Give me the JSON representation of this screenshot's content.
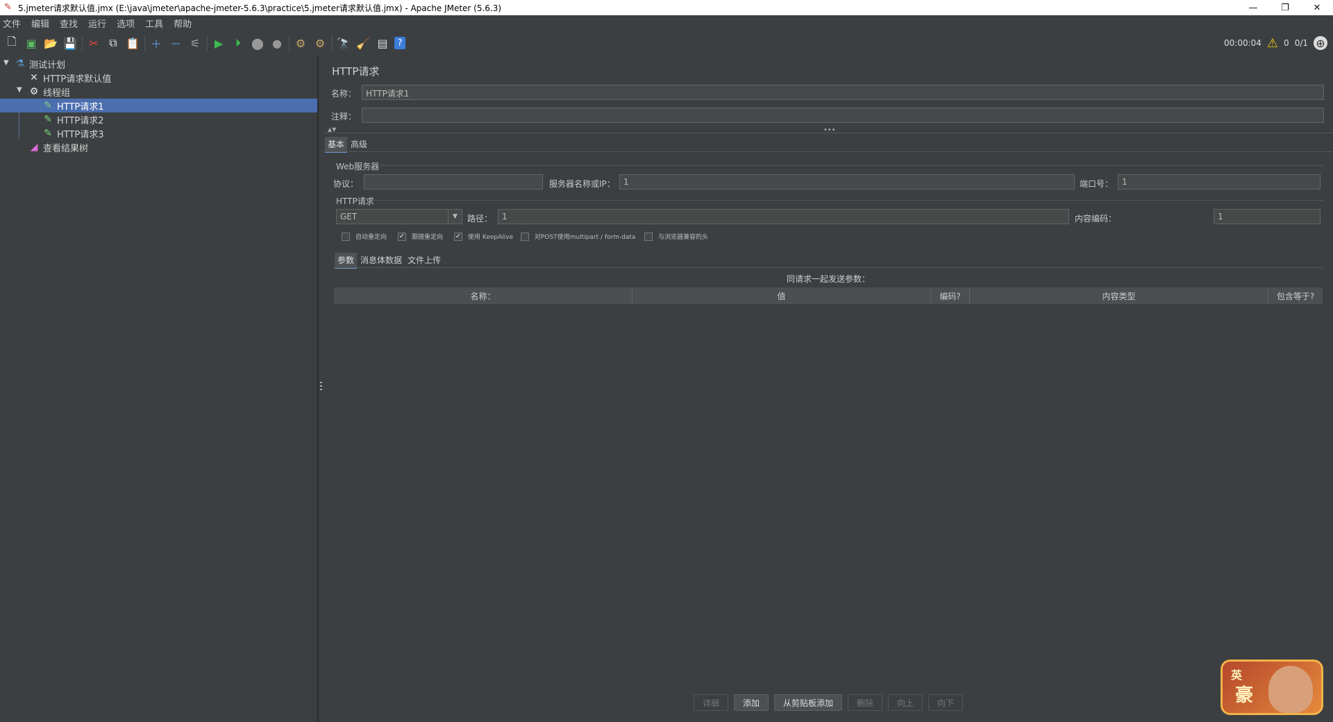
{
  "window": {
    "title": "5.jmeter请求默认值.jmx (E:\\java\\jmeter\\apache-jmeter-5.6.3\\practice\\5.jmeter请求默认值.jmx) - Apache JMeter (5.6.3)",
    "minimize": "—",
    "maximize": "❐",
    "close": "✕"
  },
  "menu": [
    "文件",
    "编辑",
    "查找",
    "运行",
    "选项",
    "工具",
    "帮助"
  ],
  "status": {
    "elapsed": "00:00:04",
    "warnings": "0",
    "threads": "0/1"
  },
  "tree": {
    "root": "测试计划",
    "defaults": "HTTP请求默认值",
    "thread_group": "线程组",
    "requests": [
      "HTTP请求1",
      "HTTP请求2",
      "HTTP请求3"
    ],
    "listener": "查看结果树"
  },
  "panel": {
    "title": "HTTP请求",
    "name_label": "名称：",
    "name_value": "HTTP请求1",
    "comment_label": "注释：",
    "comment_value": "",
    "tabs": [
      "基本",
      "高级"
    ],
    "web_server": {
      "section": "Web服务器",
      "protocol_label": "协议：",
      "protocol_value": "",
      "server_label": "服务器名称或IP：",
      "server_value": "1",
      "port_label": "端口号：",
      "port_value": "1"
    },
    "http_request": {
      "section": "HTTP请求",
      "method": "GET",
      "path_label": "路径：",
      "path_value": "1",
      "encoding_label": "内容编码：",
      "encoding_value": "1"
    },
    "checkboxes": [
      {
        "label": "自动重定向",
        "checked": false
      },
      {
        "label": "跟随重定向",
        "checked": true
      },
      {
        "label": "使用 KeepAlive",
        "checked": true
      },
      {
        "label": "对POST使用multipart / form-data",
        "checked": false
      },
      {
        "label": "与浏览器兼容的头",
        "checked": false
      }
    ],
    "subtabs": [
      "参数",
      "消息体数据",
      "文件上传"
    ],
    "params_caption": "同请求一起发送参数：",
    "columns": [
      "名称：",
      "值",
      "编码?",
      "内容类型",
      "包含等于?"
    ],
    "buttons": [
      {
        "label": "详细",
        "enabled": false
      },
      {
        "label": "添加",
        "enabled": true
      },
      {
        "label": "从剪贴板添加",
        "enabled": true
      },
      {
        "label": "删除",
        "enabled": false
      },
      {
        "label": "向上",
        "enabled": false
      },
      {
        "label": "向下",
        "enabled": false
      }
    ]
  },
  "badge": {
    "line1": "英",
    "line2": "豪"
  },
  "colors": {
    "background": "#3c3f41",
    "selection": "#4b6eaf",
    "field": "#45494a"
  }
}
